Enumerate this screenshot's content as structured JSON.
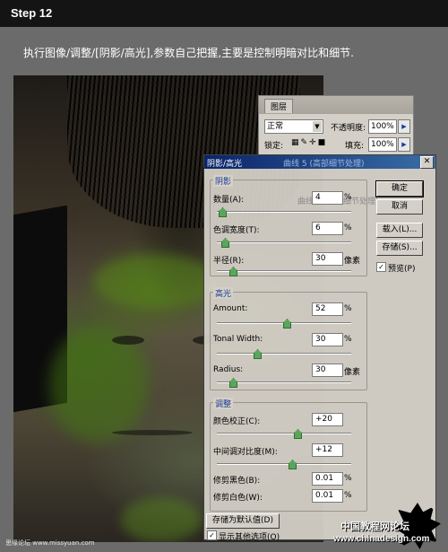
{
  "header": {
    "step": "Step 12"
  },
  "instruction": "执行图像/调整/[阴影/高光],参数自己把握,主要是控制明暗对比和细节.",
  "layers_panel": {
    "tab": "图层",
    "blend_mode": "正常",
    "opacity_label": "不透明度:",
    "opacity": "100%",
    "lock_label": "锁定:",
    "fill_label": "填充:",
    "fill": "100%"
  },
  "dialog": {
    "title": "阴影/高光",
    "ghost_title": "曲线 5 (高部细节处理)",
    "ghost_row": "曲线 4 (暗部细节处理)",
    "shadows": {
      "group": "阴影",
      "amount_label": "数量(A):",
      "amount": "4",
      "amount_unit": "%",
      "amount_level": 0.04,
      "tonal_label": "色调宽度(T):",
      "tonal": "6",
      "tonal_unit": "%",
      "tonal_level": 0.06,
      "radius_label": "半径(R):",
      "radius": "30",
      "radius_unit": "像素",
      "radius_level": 0.12
    },
    "highlights": {
      "group": "高光",
      "amount_label": "Amount:",
      "amount": "52",
      "amount_unit": "%",
      "amount_level": 0.52,
      "tonal_label": "Tonal Width:",
      "tonal": "30",
      "tonal_unit": "%",
      "tonal_level": 0.3,
      "radius_label": "Radius:",
      "radius": "30",
      "radius_unit": "像素",
      "radius_level": 0.12
    },
    "adjust": {
      "group": "调整",
      "color_label": "颜色校正(C):",
      "color": "+20",
      "color_level": 0.6,
      "midtone_label": "中间调对比度(M):",
      "midtone": "+12",
      "midtone_level": 0.56,
      "black_label": "修剪黑色(B):",
      "black": "0.01",
      "black_unit": "%",
      "white_label": "修剪白色(W):",
      "white": "0.01",
      "white_unit": "%"
    },
    "buttons": {
      "ok": "确定",
      "cancel": "取消",
      "load": "载入(L)...",
      "save": "存储(S)..."
    },
    "preview": {
      "label": "预览(P)",
      "checked": true
    },
    "save_default": "存储为默认值(D)",
    "show_more": {
      "label": "显示其他选项(O)",
      "checked": true
    },
    "accent": "#0a246a"
  },
  "footer": {
    "credit": "思缘论坛 www.missyuan.com",
    "watermark": "中国教程网论坛",
    "watermark_url": "www.chinadesign.com"
  }
}
